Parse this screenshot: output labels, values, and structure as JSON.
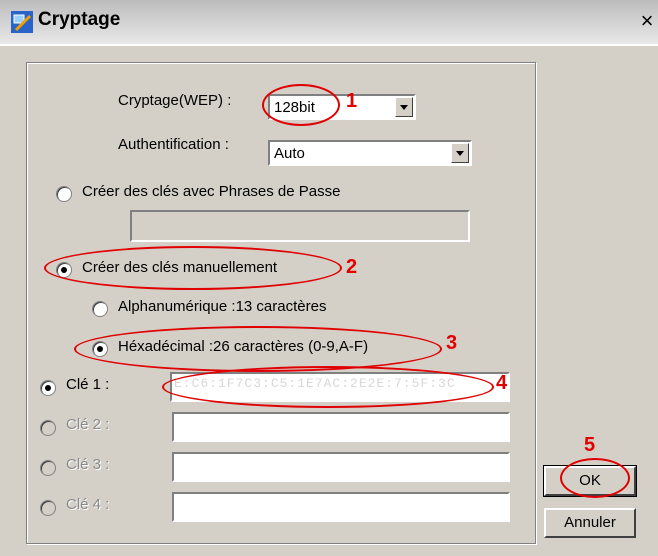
{
  "window": {
    "title": "Cryptage",
    "close_glyph": "×",
    "icon": "network-icon"
  },
  "encryption": {
    "label": "Cryptage(WEP) :",
    "value": "128bit"
  },
  "auth": {
    "label": "Authentification :",
    "value": "Auto"
  },
  "passphrase": {
    "label": "Créer des clés avec Phrases de Passe",
    "value": ""
  },
  "manual": {
    "label": "Créer des clés manuellement"
  },
  "alpha": {
    "label": "Alphanumérique :13 caractères"
  },
  "hex": {
    "label": "Héxadécimal :26 caractères (0-9,A-F)"
  },
  "keys": [
    {
      "label": "Clé 1 :",
      "value": "E:C6:1F7C3:C5:1E7AC:2E2E:7:5F:3C"
    },
    {
      "label": "Clé 2 :",
      "value": ""
    },
    {
      "label": "Clé 3 :",
      "value": ""
    },
    {
      "label": "Clé 4 :",
      "value": ""
    }
  ],
  "buttons": {
    "ok": "OK",
    "cancel": "Annuler"
  },
  "annotations": [
    "1",
    "2",
    "3",
    "4",
    "5"
  ],
  "colors": {
    "annotation": "#e00000",
    "dialog_bg": "#d4d0c8"
  }
}
